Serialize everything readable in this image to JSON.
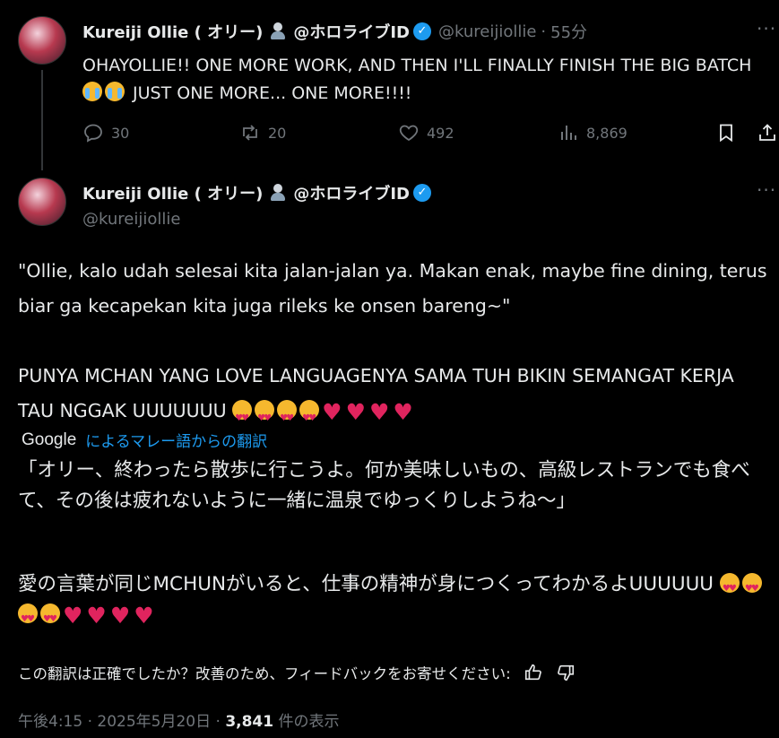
{
  "tweet1": {
    "display_name": "Kureiji Ollie ( オリー)",
    "affiliation": "@ホロライブID",
    "handle": "@kureijiollie",
    "separator": "·",
    "time_ago": "55分",
    "text": "OHAYOLLIE!! ONE MORE WORK, AND THEN I'LL FINALLY FINISH THE BIG BATCH",
    "text_tail": "JUST ONE MORE... ONE MORE!!!!",
    "replies": "30",
    "reposts": "20",
    "likes": "492",
    "views": "8,869"
  },
  "tweet2": {
    "display_name": "Kureiji Ollie ( オリー)",
    "affiliation": "@ホロライブID",
    "handle": "@kureijiollie",
    "para1": "\"Ollie, kalo udah selesai kita jalan-jalan ya. Makan enak, maybe fine dining, terus biar ga kecapekan kita juga rileks ke onsen bareng~\"",
    "para2": "PUNYA MCHAN YANG LOVE LANGUAGENYA SAMA TUH BIKIN SEMANGAT KERJA TAU NGGAK UUUUUUU",
    "translation_provider": "Google",
    "translation_label": "によるマレー語からの翻訳",
    "trans1": "「オリー、終わったら散歩に行こうよ。何か美味しいもの、高級レストランでも食べて、その後は疲れないように一緒に温泉でゆっくりしようね〜」",
    "trans2": "愛の言葉が同じMCHUNがいると、仕事の精神が身につくってわかるよUUUUUU",
    "feedback": "この翻訳は正確でしたか？改善のため、フィードバックをお寄せください:",
    "time": "午後4:15 · 2025年5月20日 ·",
    "views_count": "3,841",
    "views_label": "件の表示"
  },
  "colors": {
    "background": "#000000",
    "text": "#e7e9ea",
    "muted": "#71767b",
    "accent": "#1d9bf0",
    "heart": "#e0245e"
  },
  "icons": [
    "reply-icon",
    "repost-icon",
    "like-icon",
    "views-icon",
    "bookmark-icon",
    "share-icon",
    "more-icon",
    "verified-icon",
    "thumbs-up-icon",
    "thumbs-down-icon"
  ]
}
